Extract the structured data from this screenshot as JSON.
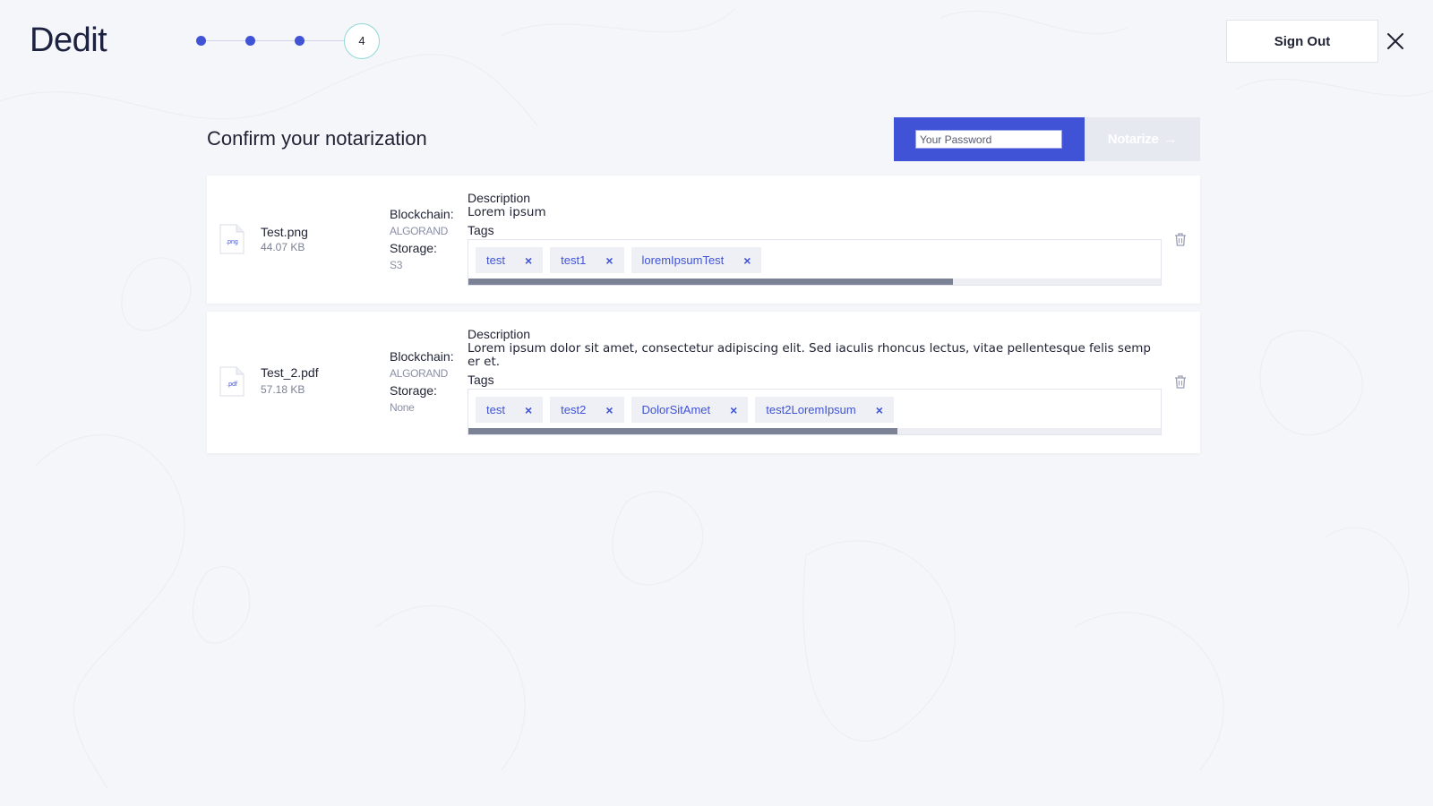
{
  "app": {
    "logo": "Dedit"
  },
  "stepper": {
    "current_step": "4",
    "completed_steps": 3
  },
  "header": {
    "sign_out_label": "Sign Out"
  },
  "main": {
    "title": "Confirm your notarization",
    "password": {
      "placeholder": "Your Password",
      "value": ""
    },
    "notarize_label": "Notarize",
    "notarize_arrow": "→"
  },
  "labels": {
    "blockchain": "Blockchain:",
    "storage": "Storage:",
    "description": "Description",
    "tags": "Tags"
  },
  "files": [
    {
      "ext": ".png",
      "name": "Test.png",
      "size": "44.07 KB",
      "blockchain": "ALGORAND",
      "storage": "S3",
      "description": "Lorem ipsum",
      "tags": [
        "test",
        "test1",
        "loremIpsumTest"
      ],
      "tags_scroll_fraction": 0.7
    },
    {
      "ext": ".pdf",
      "name": "Test_2.pdf",
      "size": "57.18 KB",
      "blockchain": "ALGORAND",
      "storage": "None",
      "description": "Lorem ipsum dolor sit amet, consectetur adipiscing elit. Sed iaculis rhoncus lectus, vitae pellentesque felis semper et.",
      "tags": [
        "test",
        "test2",
        "DolorSitAmet",
        "test2LoremIpsum"
      ],
      "tags_scroll_fraction": 0.62
    }
  ],
  "icons": {
    "close": "close-icon",
    "trash": "trash-icon",
    "file": "file-icon",
    "tag_remove": "×"
  },
  "colors": {
    "accent": "#4053d6",
    "background": "#f5f6f9",
    "step_ring": "#8fd8d6",
    "disabled_button": "#e7e9f1"
  }
}
